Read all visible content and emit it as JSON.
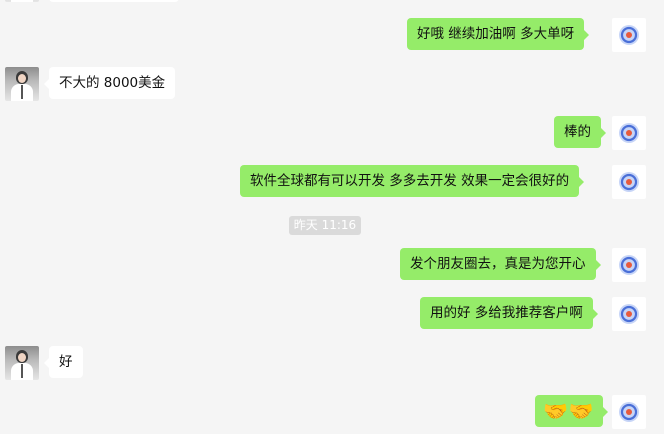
{
  "colors": {
    "background": "#f5f5f5",
    "incoming_bubble": "#ffffff",
    "outgoing_bubble": "#95ec69",
    "timestamp_bg": "#dadada"
  },
  "timestamp": "昨天 11:16",
  "messages": [
    {
      "side": "out",
      "text": "好哦  继续加油啊   多大单呀"
    },
    {
      "side": "in",
      "text": "不大的 8000美金"
    },
    {
      "side": "out",
      "text": "棒的"
    },
    {
      "side": "out",
      "text": "软件全球都有可以开发   多多去开发  效果一定会很好的"
    },
    {
      "side": "out",
      "text": "发个朋友圈去，真是为您开心"
    },
    {
      "side": "out",
      "text": "用的好  多给我推荐客户啊"
    },
    {
      "side": "in",
      "text": "好"
    },
    {
      "side": "out",
      "text": "🤝🤝",
      "icon": "handshake-emoji"
    }
  ]
}
